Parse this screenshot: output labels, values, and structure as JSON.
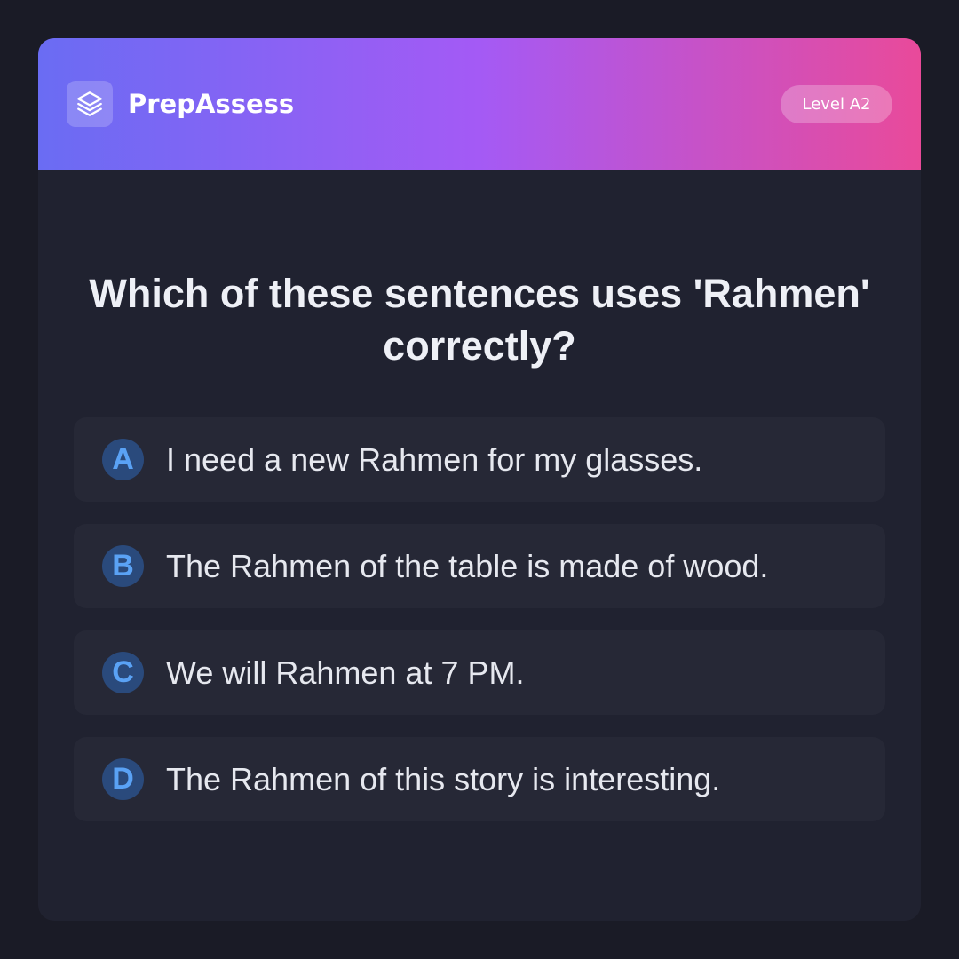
{
  "header": {
    "brand": "PrepAssess",
    "level": "Level A2",
    "logo_icon": "layers-icon"
  },
  "question": "Which of these sentences uses 'Rahmen' correctly?",
  "options": [
    {
      "letter": "A",
      "text": "I need a new Rahmen for my glasses."
    },
    {
      "letter": "B",
      "text": "The Rahmen of the table is made of wood."
    },
    {
      "letter": "C",
      "text": "We will Rahmen at 7 PM."
    },
    {
      "letter": "D",
      "text": "The Rahmen of this story is interesting."
    }
  ],
  "colors": {
    "gradient_start": "#6a6cf3",
    "gradient_mid": "#a45af5",
    "gradient_end": "#e94a9a",
    "card_bg": "#202230",
    "option_bg": "#262836",
    "letter_accent": "#5aa2f5"
  }
}
